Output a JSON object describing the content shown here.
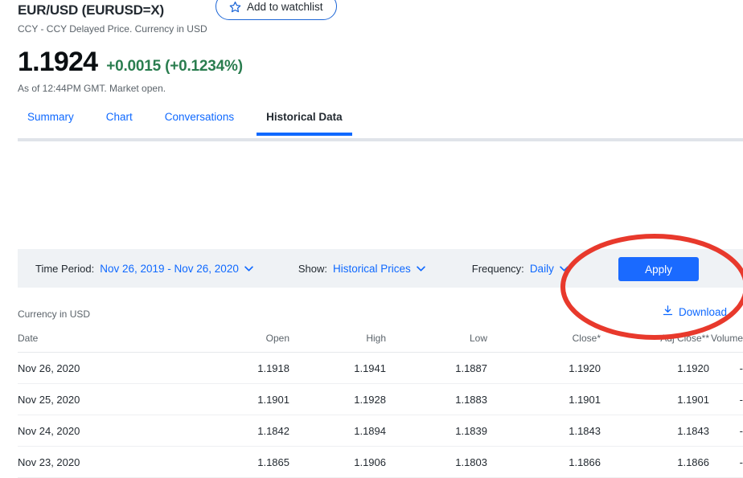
{
  "quote": {
    "title": "EUR/USD (EURUSD=X)",
    "watchlist_label": "Add to watchlist",
    "watchlist_icon": "star-icon",
    "subtitle": "CCY - CCY Delayed Price. Currency in USD",
    "price": "1.1924",
    "change": "+0.0015 (+0.1234%)",
    "change_color": "#2a7d4f",
    "as_of": "As of 12:44PM GMT. Market open."
  },
  "tabs": [
    {
      "label": "Summary",
      "active": false
    },
    {
      "label": "Chart",
      "active": false
    },
    {
      "label": "Conversations",
      "active": false
    },
    {
      "label": "Historical Data",
      "active": true
    }
  ],
  "filters": {
    "time_period_label": "Time Period:",
    "time_period_value": "Nov 26, 2019 - Nov 26, 2020",
    "show_label": "Show:",
    "show_value": "Historical Prices",
    "frequency_label": "Frequency:",
    "frequency_value": "Daily",
    "apply_label": "Apply",
    "chevron_icon": "chevron-down-icon"
  },
  "meta": {
    "currency_note": "Currency in USD",
    "download_label": "Download",
    "download_icon": "download-icon"
  },
  "table": {
    "headers": [
      "Date",
      "Open",
      "High",
      "Low",
      "Close*",
      "Adj Close**",
      "Volume"
    ],
    "rows": [
      {
        "date": "Nov 26, 2020",
        "open": "1.1918",
        "high": "1.1941",
        "low": "1.1887",
        "close": "1.1920",
        "adj_close": "1.1920",
        "volume": "-"
      },
      {
        "date": "Nov 25, 2020",
        "open": "1.1901",
        "high": "1.1928",
        "low": "1.1883",
        "close": "1.1901",
        "adj_close": "1.1901",
        "volume": "-"
      },
      {
        "date": "Nov 24, 2020",
        "open": "1.1842",
        "high": "1.1894",
        "low": "1.1839",
        "close": "1.1843",
        "adj_close": "1.1843",
        "volume": "-"
      },
      {
        "date": "Nov 23, 2020",
        "open": "1.1865",
        "high": "1.1906",
        "low": "1.1803",
        "close": "1.1866",
        "adj_close": "1.1866",
        "volume": "-"
      }
    ]
  },
  "annotation": {
    "shape": "ellipse-highlight",
    "color": "#e8392c"
  },
  "theme": {
    "link": "#0f69ff",
    "primary_button": "#1a6aff",
    "filter_bar_bg": "#eff2f5"
  }
}
